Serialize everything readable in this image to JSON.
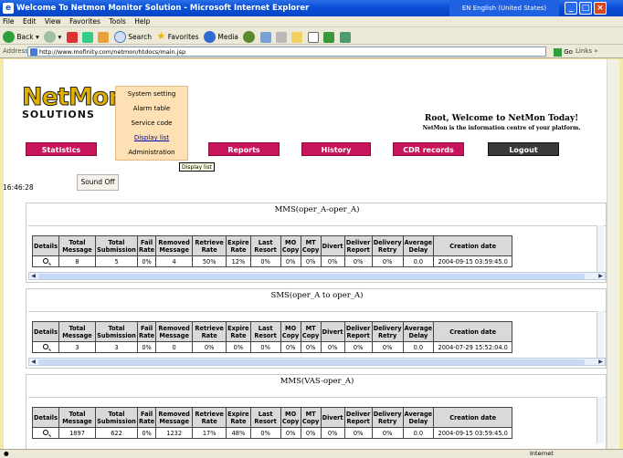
{
  "window": {
    "title": "Welcome To Netmon Monitor Solution - Microsoft Internet Explorer",
    "language": "EN English (United States)"
  },
  "menubar": [
    "File",
    "Edit",
    "View",
    "Favorites",
    "Tools",
    "Help"
  ],
  "toolbar": {
    "back": "Back",
    "search": "Search",
    "favorites": "Favorites",
    "media": "Media"
  },
  "address": {
    "label": "Address",
    "url": "http://www.mofinity.com/netmon/htdocs/main.jsp",
    "go": "Go",
    "links": "Links"
  },
  "logo": {
    "name": "NetMon",
    "sub": "SOLUTIONS"
  },
  "dropdown_menu": [
    "System setting",
    "Alarm table",
    "Service code",
    "Display list",
    "Administration"
  ],
  "tooltip": "Display list",
  "welcome": {
    "line1": "Root, Welcome to NetMon Today!",
    "line2": "NetMon is the information centre of your platform."
  },
  "nav": {
    "statistics": "Statistics",
    "reports": "Reports",
    "history": "History",
    "cdr": "CDR records",
    "logout": "Logout"
  },
  "clock": "16:46:28",
  "sound_button": "Sound Off",
  "columns": [
    "Details",
    "Total Message",
    "Total Submission",
    "Fail Rate",
    "Removed Message",
    "Retrieve Rate",
    "Expire Rate",
    "Last Resort",
    "MO Copy",
    "MT Copy",
    "Divert",
    "Deliver Report",
    "Delivery Retry",
    "Average Delay",
    "Creation date"
  ],
  "panels": [
    {
      "title": "MMS(oper_A-oper_A)",
      "row": [
        "8",
        "5",
        "0%",
        "4",
        "50%",
        "12%",
        "0%",
        "0%",
        "0%",
        "0%",
        "0%",
        "0%",
        "0.0",
        "2004-09-15 03:59:45.0"
      ]
    },
    {
      "title": "SMS(oper_A to oper_A)",
      "row": [
        "3",
        "3",
        "0%",
        "0",
        "0%",
        "0%",
        "0%",
        "0%",
        "0%",
        "0%",
        "0%",
        "0%",
        "0.0",
        "2004-07-29 15:52:04.0"
      ]
    },
    {
      "title": "MMS(VAS-oper_A)",
      "row": [
        "1897",
        "622",
        "0%",
        "1232",
        "17%",
        "48%",
        "0%",
        "0%",
        "0%",
        "0%",
        "0%",
        "0%",
        "0.0",
        "2004-09-15 03:59:45.0"
      ]
    }
  ],
  "status": {
    "zone": "Internet"
  },
  "colors": {
    "nav_pink": "#c8145a",
    "logout": "#3a3a3a",
    "menu_bg": "#fde1b4",
    "page_border": "#f5e9a8"
  }
}
